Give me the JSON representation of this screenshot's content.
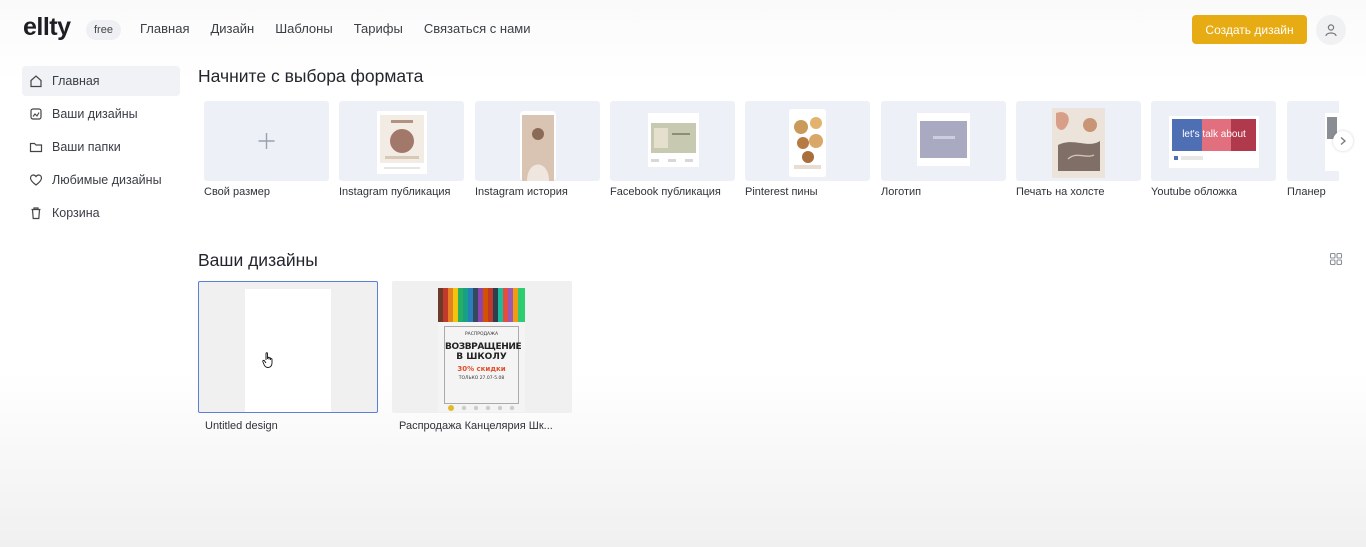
{
  "app": {
    "logo": "ellty",
    "plan_badge": "free"
  },
  "nav": [
    "Главная",
    "Дизайн",
    "Шаблоны",
    "Тарифы",
    "Связаться с нами"
  ],
  "header": {
    "create_button": "Создать дизайн",
    "avatar_icon": "user-icon"
  },
  "sidebar": {
    "items": [
      {
        "label": "Главная",
        "icon": "home-icon",
        "active": true
      },
      {
        "label": "Ваши дизайны",
        "icon": "designs-icon"
      },
      {
        "label": "Ваши папки",
        "icon": "folder-icon"
      },
      {
        "label": "Любимые дизайны",
        "icon": "heart-icon"
      },
      {
        "label": "Корзина",
        "icon": "trash-icon"
      }
    ]
  },
  "formats": {
    "title": "Начните с выбора формата",
    "items": [
      {
        "label": "Свой размер"
      },
      {
        "label": "Instagram публикация"
      },
      {
        "label": "Instagram история"
      },
      {
        "label": "Facebook публикация"
      },
      {
        "label": "Pinterest пины"
      },
      {
        "label": "Логотип"
      },
      {
        "label": "Печать на холсте"
      },
      {
        "label": "Youtube обложка",
        "thumb_text": "let's talk about"
      },
      {
        "label": "Планер"
      }
    ]
  },
  "designs": {
    "title": "Ваши дизайны",
    "items": [
      {
        "label": "Untitled design"
      },
      {
        "label": "Распродажа Канцелярия Шк...",
        "poster": {
          "kicker": "РАСПРОДАЖА",
          "line1": "ВОЗВРАЩЕНИЕ",
          "line2": "В ШКОЛУ",
          "discount": "30% скидки",
          "date": "ТОЛЬКО 27.07-5.08"
        }
      }
    ]
  },
  "colors": {
    "accent": "#e7ac14",
    "selection": "#5b7fd6",
    "thumb_bg": "#edf1f7"
  }
}
